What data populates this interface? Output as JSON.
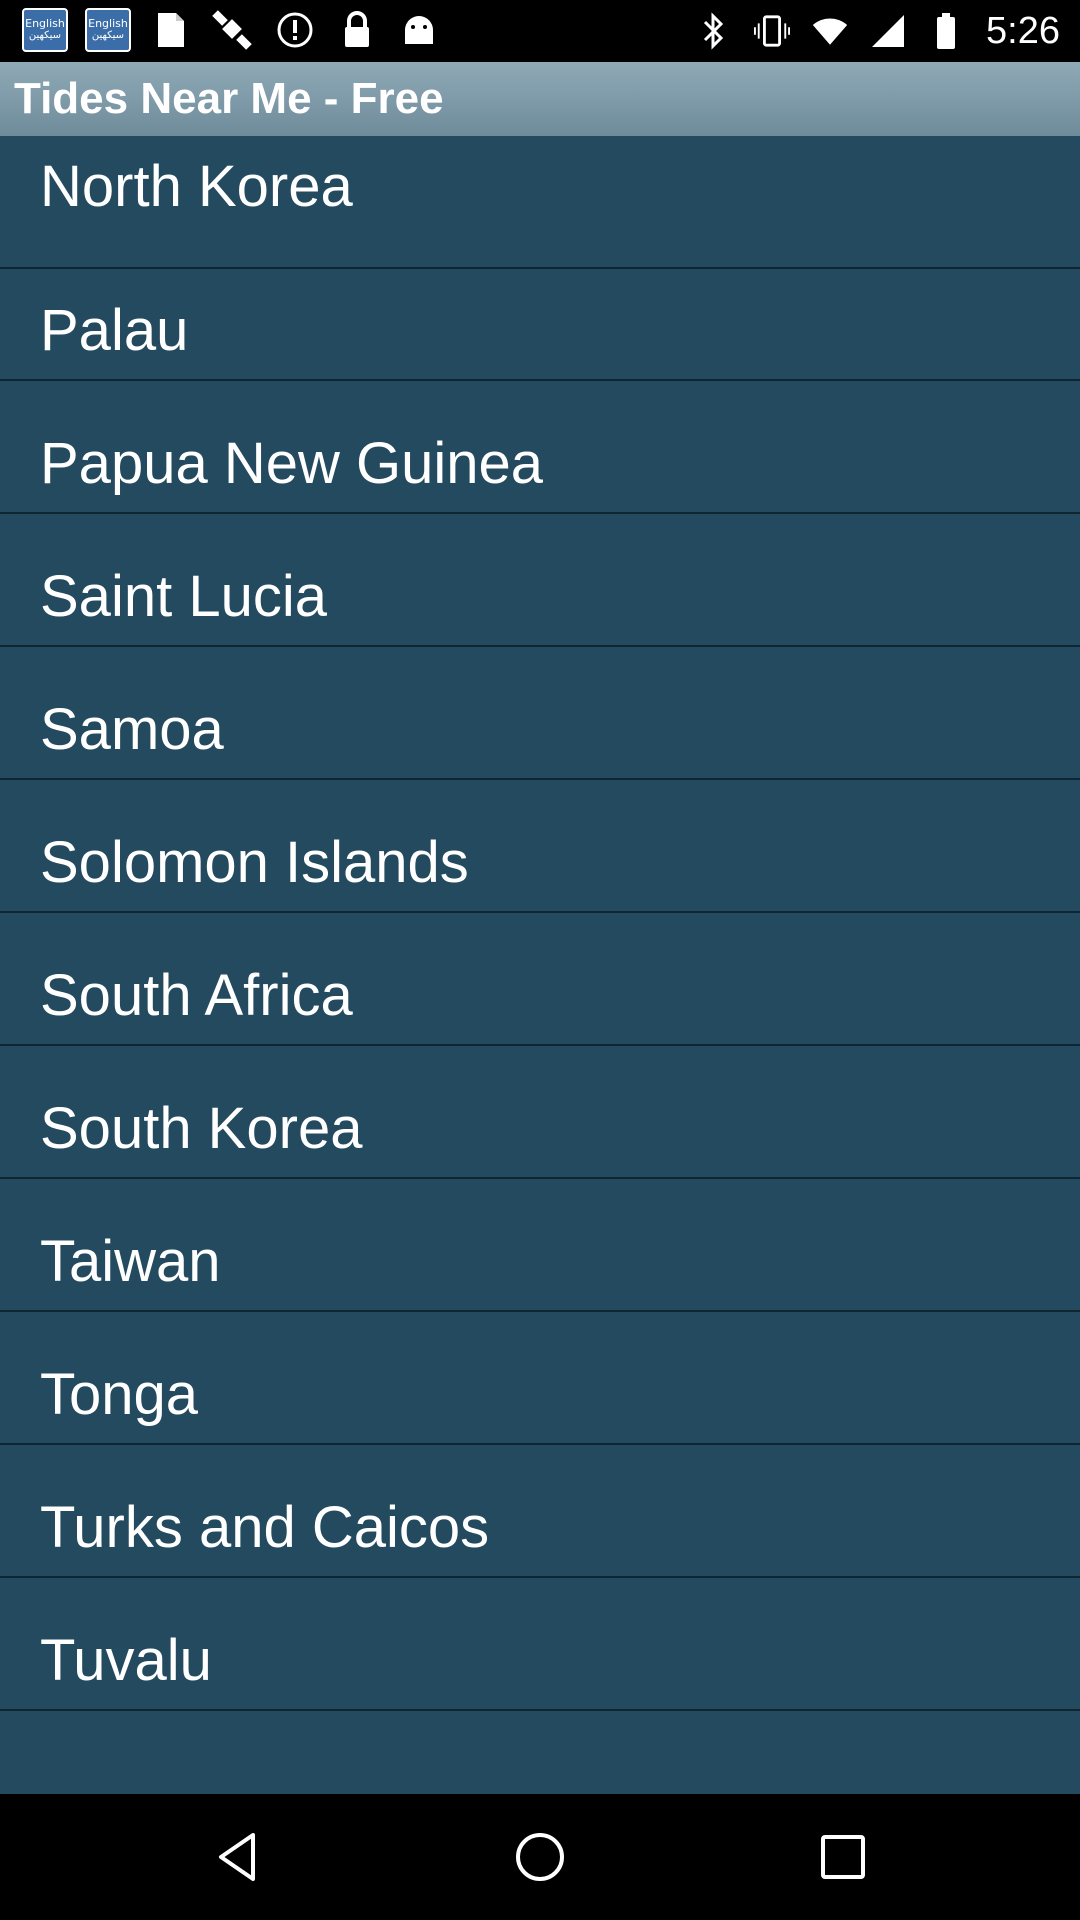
{
  "status_bar": {
    "keyboard_icons": [
      {
        "line1": "English",
        "line2": "سيكهين"
      },
      {
        "line1": "English",
        "line2": "سيكهين"
      }
    ],
    "left_icons": [
      "document-icon",
      "fake-gps-satellite-icon",
      "alert-icon",
      "lock-icon",
      "android-icon"
    ],
    "right_icons": [
      "bluetooth-icon",
      "vibrate-icon",
      "wifi-icon",
      "signal-icon",
      "battery-icon"
    ],
    "time": "5:26"
  },
  "app_bar": {
    "title": "Tides Near Me - Free",
    "color": "#7f9aa8"
  },
  "list": {
    "background_color": "#244a5f",
    "items": [
      {
        "label": "North Korea"
      },
      {
        "label": "Palau"
      },
      {
        "label": "Papua New Guinea"
      },
      {
        "label": "Saint Lucia"
      },
      {
        "label": "Samoa"
      },
      {
        "label": "Solomon Islands"
      },
      {
        "label": "South Africa"
      },
      {
        "label": "South Korea"
      },
      {
        "label": "Taiwan"
      },
      {
        "label": "Tonga"
      },
      {
        "label": "Turks and Caicos"
      },
      {
        "label": "Tuvalu"
      },
      {
        "label": ""
      }
    ]
  },
  "nav_bar": {
    "buttons": [
      "back-icon",
      "home-icon",
      "recent-apps-icon"
    ]
  }
}
